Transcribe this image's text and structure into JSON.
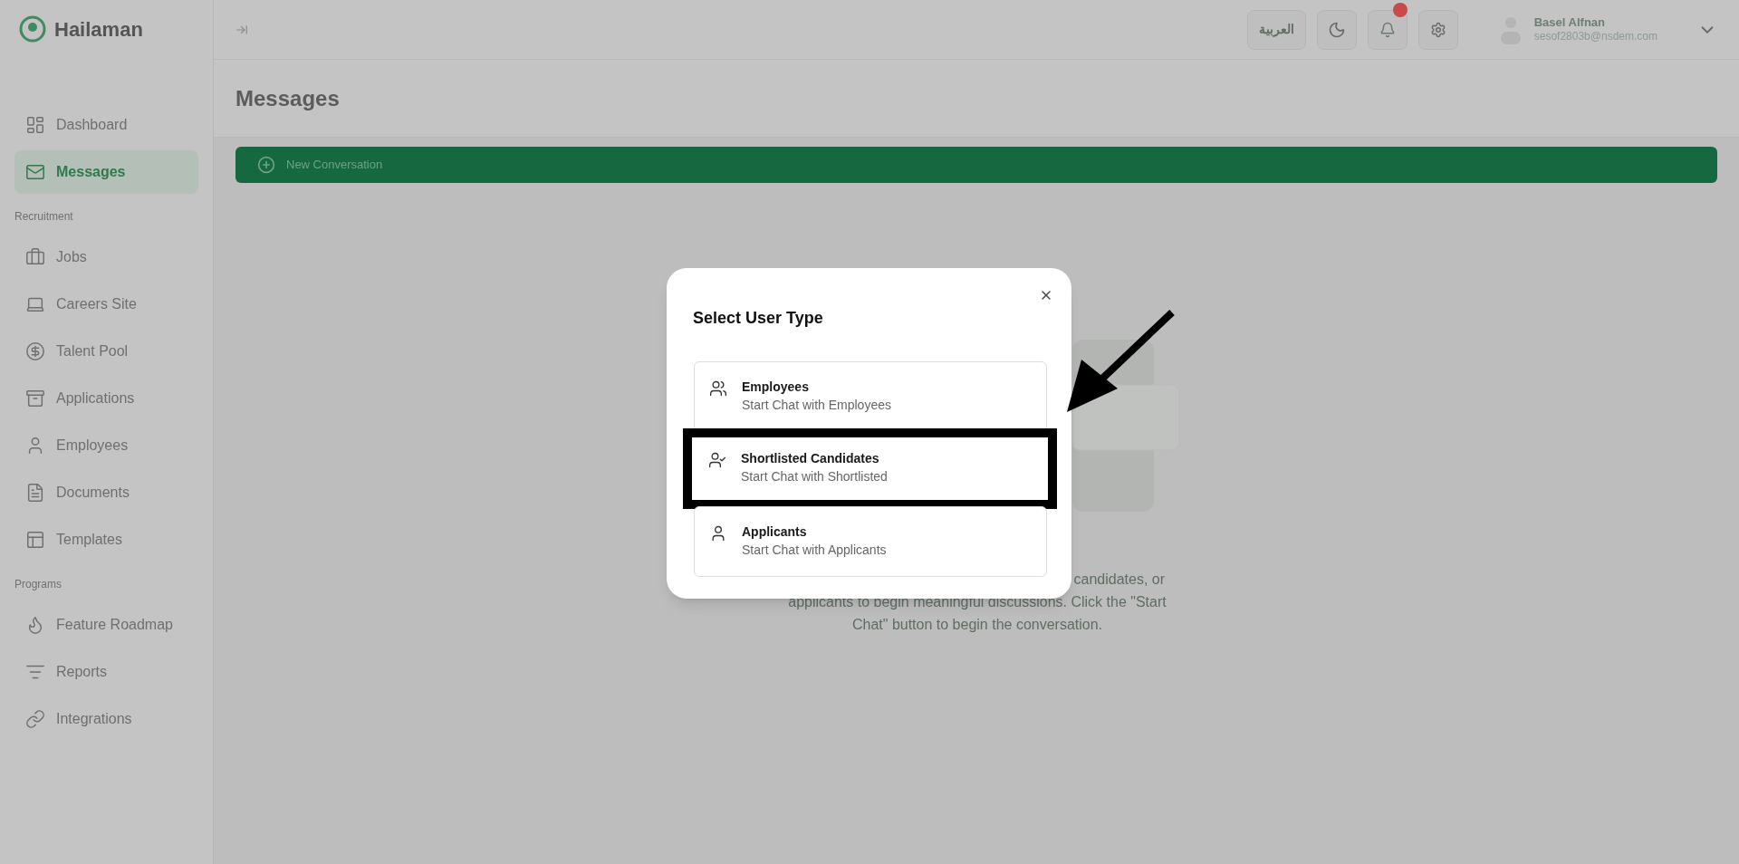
{
  "brand": "Hailaman",
  "sidebar": {
    "sections": [
      {
        "items": [
          {
            "label": "Dashboard",
            "kind": "dashboard",
            "selected": false
          },
          {
            "label": "Messages",
            "kind": "messages",
            "selected": true
          }
        ]
      },
      {
        "title": "Recruitment",
        "items": [
          {
            "label": "Jobs",
            "kind": "jobs",
            "selected": false
          },
          {
            "label": "Careers Site",
            "kind": "careers",
            "selected": false
          },
          {
            "label": "Talent Pool",
            "kind": "talent",
            "selected": false
          },
          {
            "label": "Applications",
            "kind": "applications",
            "selected": false
          },
          {
            "label": "Employees",
            "kind": "employees",
            "selected": false
          },
          {
            "label": "Documents",
            "kind": "documents",
            "selected": false
          },
          {
            "label": "Templates",
            "kind": "templates",
            "selected": false
          }
        ]
      },
      {
        "title": "Programs",
        "items": [
          {
            "label": "Feature Roadmap",
            "kind": "roadmap",
            "selected": false
          },
          {
            "label": "Reports",
            "kind": "reports",
            "selected": false
          },
          {
            "label": "Integrations",
            "kind": "integrations",
            "selected": false
          }
        ]
      }
    ]
  },
  "topbar": {
    "language": "العربية",
    "unread_notifications": true,
    "user": {
      "name": "Basel Alfnan",
      "email": "sesof2803b@nsdem.com"
    }
  },
  "page": {
    "title": "Messages",
    "new_button": "New Conversation",
    "empty_text_lines": [
      "candidates, or",
      "applicants to begin meaningful discussions. Click the \"Start",
      "Chat\" button to begin the conversation."
    ]
  },
  "dialog": {
    "title": "Select User Type",
    "options": [
      {
        "kind": "employees",
        "title": "Employees",
        "subtitle": "Start Chat with Employees",
        "highlighted": false
      },
      {
        "kind": "shortlisted",
        "title": "Shortlisted Candidates",
        "subtitle": "Start Chat with Shortlisted",
        "highlighted": true
      },
      {
        "kind": "applicants",
        "title": "Applicants",
        "subtitle": "Start Chat with Applicants",
        "highlighted": false
      }
    ]
  }
}
